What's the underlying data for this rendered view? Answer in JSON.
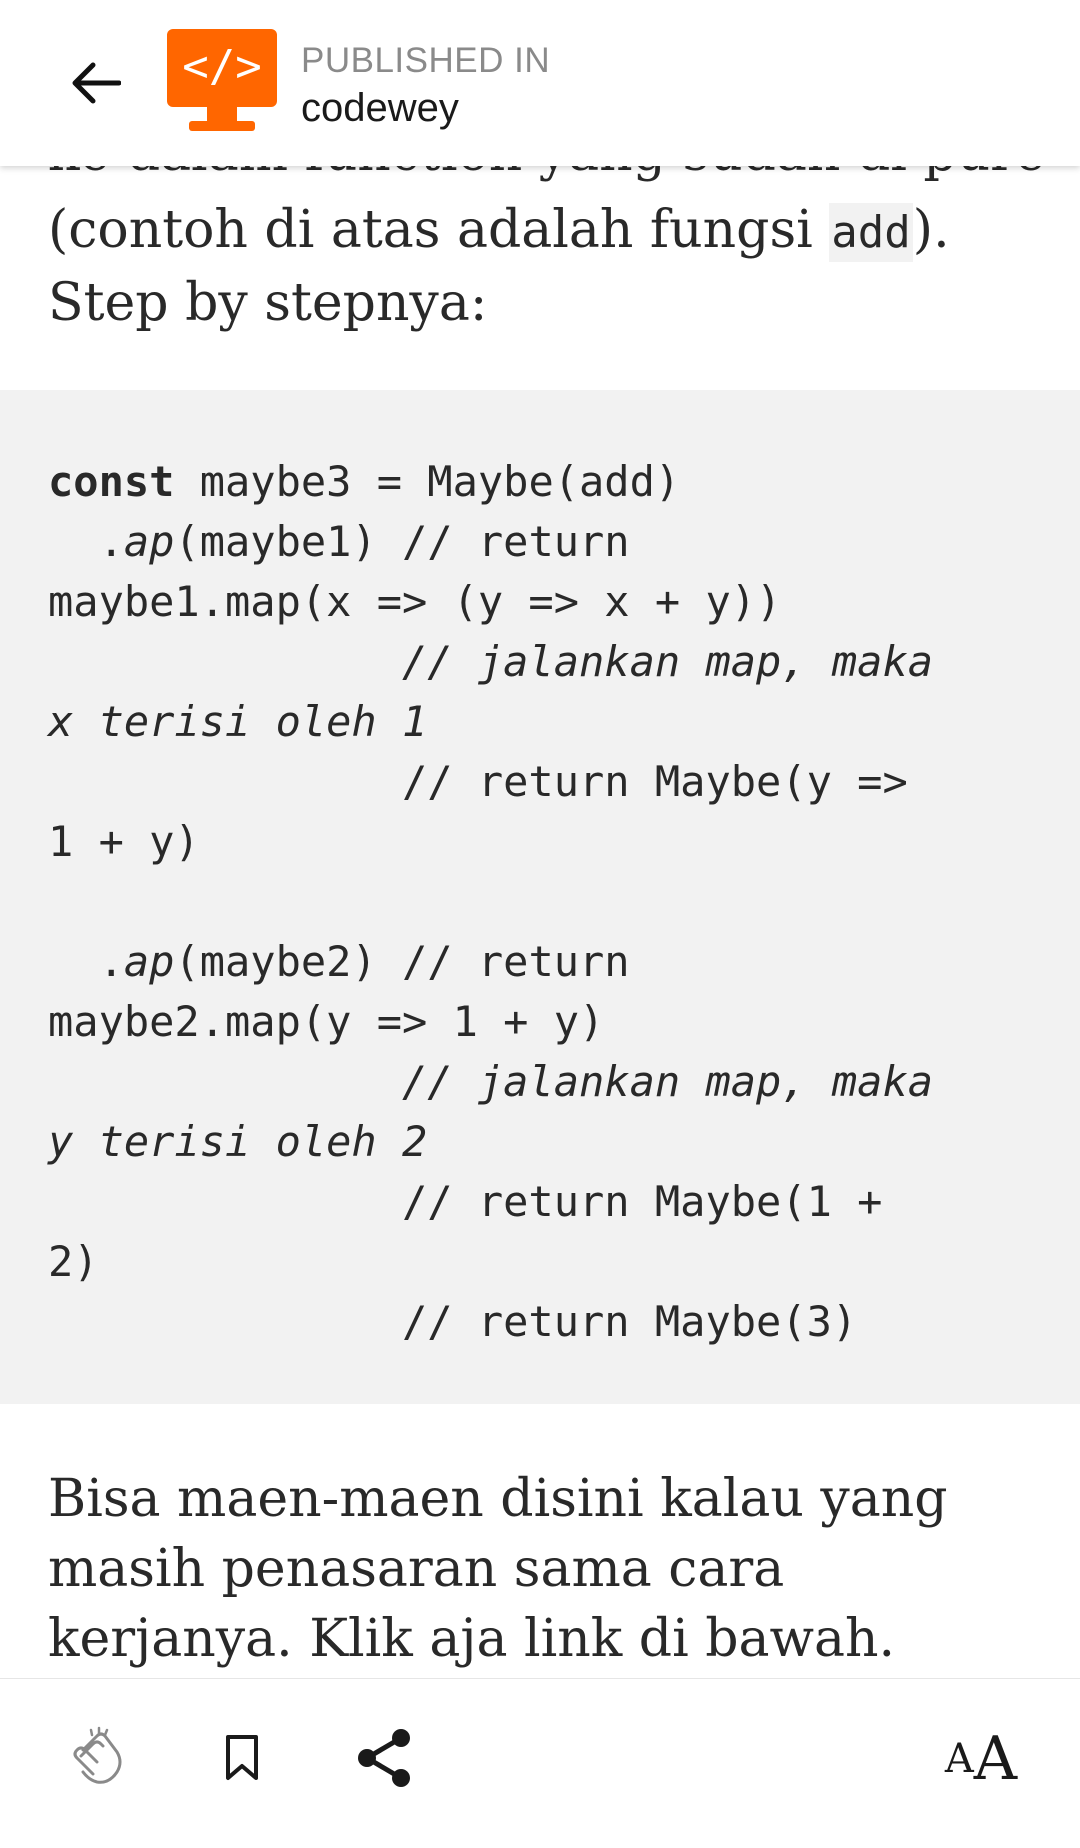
{
  "header": {
    "kicker": "PUBLISHED IN",
    "publication": "codewey",
    "logo_text": "</>",
    "brand_color": "#ff6600"
  },
  "article": {
    "clipped_line": "ke dalam function yang sudah di pure",
    "para1": {
      "before": "(contoh di atas adalah fungsi ",
      "code": "add",
      "after": "). Step by stepnya:"
    },
    "code": {
      "l1_kw": "const",
      "l1_rest": " maybe3 = Maybe(add)",
      "l2_dot": "  .",
      "l2_ap": "ap",
      "l2_rest": "(maybe1) // return",
      "l3": "maybe1.map(x => (y => x + y))",
      "l4": "              // jalankan map, maka",
      "l5": "x terisi oleh 1",
      "l6": "              // return Maybe(y =>",
      "l7": "1 + y)",
      "l9_dot": "  .",
      "l9_ap": "ap",
      "l9_rest": "(maybe2) // return",
      "l10": "maybe2.map(y => 1 + y)",
      "l11": "              // jalankan map, maka",
      "l12": "y terisi oleh 2",
      "l13": "              // return Maybe(1 +",
      "l14": "2)",
      "l15": "              // return Maybe(3)"
    },
    "para2": "Bisa maen-maen disini kalau yang masih penasaran sama cara kerjanya. Klik aja link di bawah."
  },
  "bottombar": {
    "font_small": "A",
    "font_large": "A"
  },
  "icons": {
    "back": "arrow-left-icon",
    "clap": "clap-icon",
    "bookmark": "bookmark-icon",
    "share": "share-icon"
  }
}
